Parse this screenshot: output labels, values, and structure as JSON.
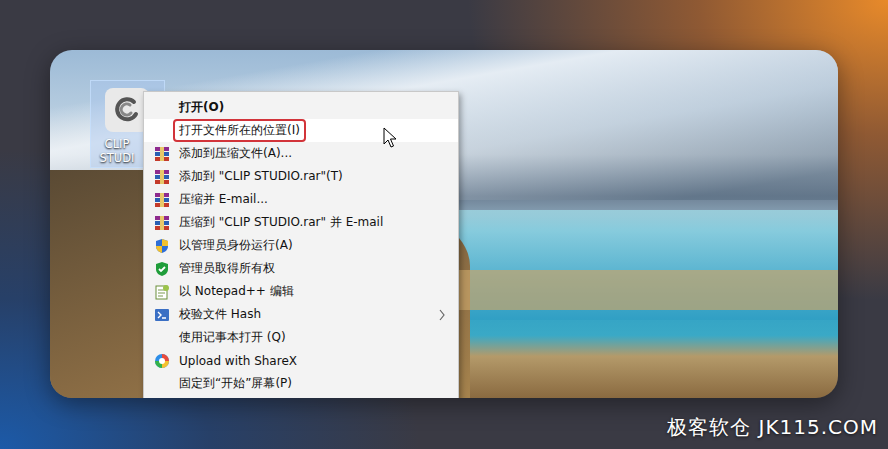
{
  "desktop": {
    "icon": {
      "label_lines": [
        "CLIP",
        "STUDI"
      ],
      "selected": true
    }
  },
  "context_menu": {
    "items": [
      {
        "label": "打开(O)",
        "default": true,
        "hovered": false,
        "marked": false,
        "submenu": false
      },
      {
        "label": "打开文件所在的位置(I)",
        "default": false,
        "hovered": true,
        "marked": true,
        "submenu": false
      },
      {
        "label": "添加到压缩文件(A)...",
        "default": false,
        "hovered": false,
        "marked": false,
        "submenu": false
      },
      {
        "label": "添加到 \"CLIP STUDIO.rar\"(T)",
        "default": false,
        "hovered": false,
        "marked": false,
        "submenu": false
      },
      {
        "label": "压缩并 E-mail...",
        "default": false,
        "hovered": false,
        "marked": false,
        "submenu": false
      },
      {
        "label": "压缩到 \"CLIP STUDIO.rar\" 并 E-mail",
        "default": false,
        "hovered": false,
        "marked": false,
        "submenu": false
      },
      {
        "label": "以管理员身份运行(A)",
        "default": false,
        "hovered": false,
        "marked": false,
        "submenu": false
      },
      {
        "label": "管理员取得所有权",
        "default": false,
        "hovered": false,
        "marked": false,
        "submenu": false
      },
      {
        "label": "以 Notepad++ 编辑",
        "default": false,
        "hovered": false,
        "marked": false,
        "submenu": false
      },
      {
        "label": "校验文件 Hash",
        "default": false,
        "hovered": false,
        "marked": false,
        "submenu": true
      },
      {
        "label": "使用记事本打开 (Q)",
        "default": false,
        "hovered": false,
        "marked": false,
        "submenu": false
      },
      {
        "label": "Upload with ShareX",
        "default": false,
        "hovered": false,
        "marked": false,
        "submenu": false
      },
      {
        "label": "固定到“开始”屏幕(P)",
        "default": false,
        "hovered": false,
        "marked": false,
        "submenu": false
      }
    ]
  },
  "watermark": "极客软仓 JK115.COM"
}
